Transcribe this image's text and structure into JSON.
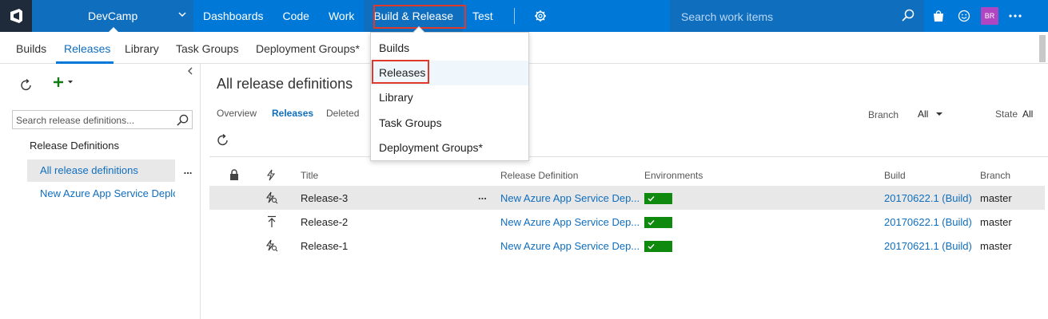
{
  "topbar": {
    "project_name": "DevCamp",
    "nav": [
      "Dashboards",
      "Code",
      "Work",
      "Build & Release",
      "Test"
    ],
    "search_placeholder": "Search work items",
    "avatar_initials": "BR",
    "accent_color": "#0078d7"
  },
  "subnav": {
    "tabs": [
      "Builds",
      "Releases",
      "Library",
      "Task Groups",
      "Deployment Groups*"
    ],
    "active": "Releases"
  },
  "build_release_menu": {
    "items": [
      "Builds",
      "Releases",
      "Library",
      "Task Groups",
      "Deployment Groups*"
    ],
    "highlighted": "Releases"
  },
  "left_panel": {
    "search_placeholder": "Search release definitions...",
    "heading": "Release Definitions",
    "items": [
      "All release definitions",
      "New Azure App Service Deploym..."
    ],
    "more": "..."
  },
  "main": {
    "title": "All release definitions",
    "pivots": [
      "Overview",
      "Releases",
      "Deleted"
    ],
    "active_pivot": "Releases",
    "filters": {
      "branch_label": "Branch",
      "branch_value": "All",
      "state_label": "State",
      "state_value": "All"
    },
    "columns": [
      "Title",
      "Release Definition",
      "Environments",
      "Build",
      "Branch"
    ],
    "rows": [
      {
        "title": "Release-3",
        "definition": "New Azure App Service Dep...",
        "build": "20170622.1 (Build)",
        "branch": "master",
        "env_status": "succeeded",
        "trigger_icon": "continuous-deployment-icon"
      },
      {
        "title": "Release-2",
        "definition": "New Azure App Service Dep...",
        "build": "20170622.1 (Build)",
        "branch": "master",
        "env_status": "succeeded",
        "trigger_icon": "manual-release-icon"
      },
      {
        "title": "Release-1",
        "definition": "New Azure App Service Dep...",
        "build": "20170621.1 (Build)",
        "branch": "master",
        "env_status": "succeeded",
        "trigger_icon": "continuous-deployment-icon"
      }
    ],
    "row_more": "..."
  },
  "colors": {
    "link": "#106ebe",
    "success": "#0f8a0f",
    "highlight_box": "#e0392b"
  }
}
